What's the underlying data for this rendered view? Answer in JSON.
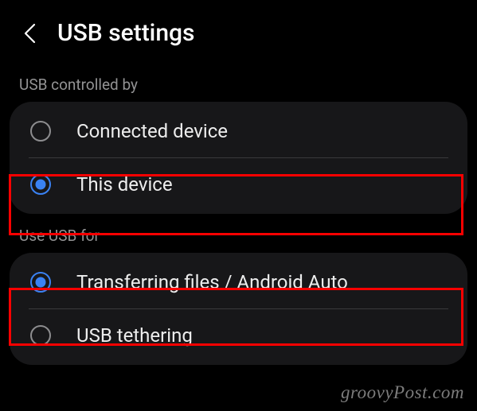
{
  "header": {
    "title": "USB settings"
  },
  "sections": {
    "controlled_by": {
      "label": "USB controlled by",
      "options": {
        "connected_device": "Connected device",
        "this_device": "This device"
      }
    },
    "use_for": {
      "label": "Use USB for",
      "options": {
        "transferring_files": "Transferring files / Android Auto",
        "usb_tethering": "USB tethering"
      }
    }
  },
  "watermark": "groovyPost.com"
}
